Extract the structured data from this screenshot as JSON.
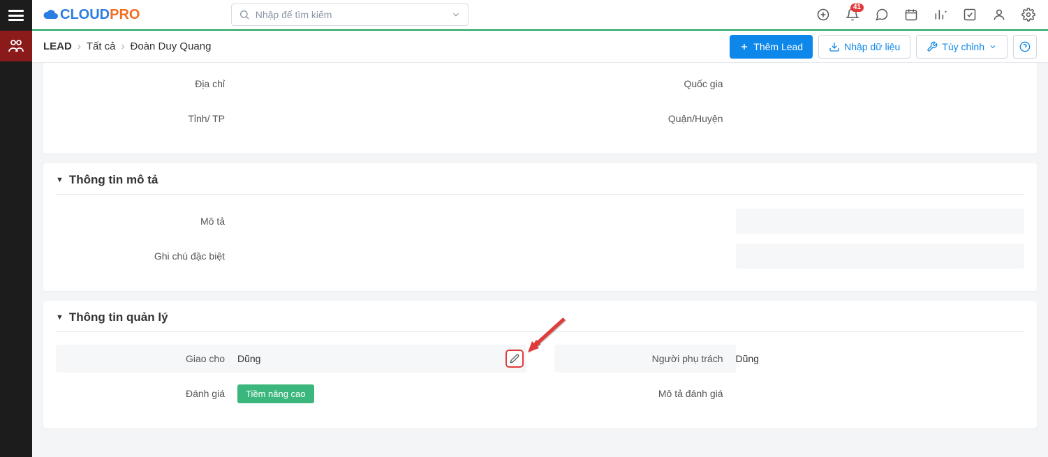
{
  "topbar": {
    "search_placeholder": "Nhập để tìm kiếm",
    "notification_count": "41"
  },
  "breadcrumb": {
    "module": "LEAD",
    "filter": "Tất cả",
    "record": "Đoàn Duy Quang"
  },
  "actions": {
    "add_lead": "Thêm Lead",
    "import": "Nhập dữ liệu",
    "customize": "Tùy chỉnh"
  },
  "card_address": {
    "fields": {
      "dia_chi": {
        "label": "Địa chỉ",
        "value": ""
      },
      "quoc_gia": {
        "label": "Quốc gia",
        "value": ""
      },
      "tinh_tp": {
        "label": "Tỉnh/ TP",
        "value": ""
      },
      "quan_huyen": {
        "label": "Quận/Huyện",
        "value": ""
      }
    }
  },
  "card_desc": {
    "title": "Thông tin mô tả",
    "fields": {
      "mo_ta": {
        "label": "Mô tả",
        "value": ""
      },
      "ghi_chu": {
        "label": "Ghi chú đặc biệt",
        "value": ""
      }
    }
  },
  "card_mgmt": {
    "title": "Thông tin quản lý",
    "fields": {
      "giao_cho": {
        "label": "Giao cho",
        "value": "Dũng"
      },
      "nguoi_phu_trach": {
        "label": "Người phụ trách",
        "value": "Dũng"
      },
      "danh_gia": {
        "label": "Đánh giá",
        "value": "Tiềm năng cao"
      },
      "mo_ta_danh_gia": {
        "label": "Mô tả đánh giá",
        "value": ""
      }
    }
  }
}
